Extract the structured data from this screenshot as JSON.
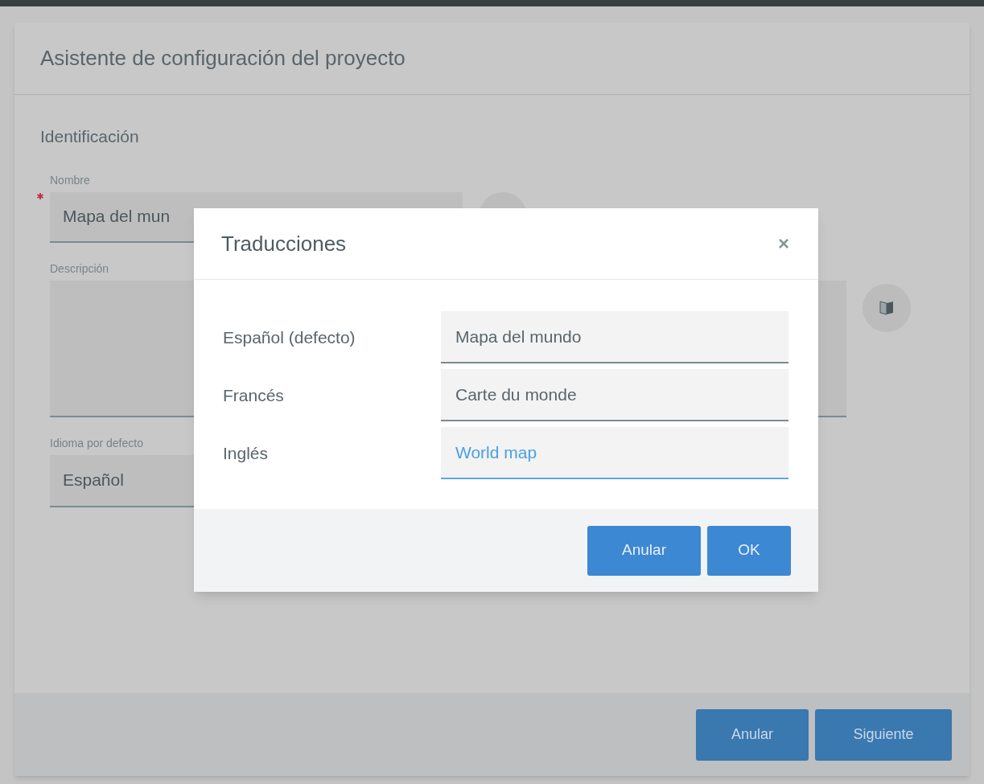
{
  "wizard": {
    "title": "Asistente de configuración del proyecto",
    "section": "Identificación",
    "fields": [
      {
        "kind": "input",
        "label": "Nombre",
        "required": true,
        "value": "Mapa del mun"
      },
      {
        "kind": "textarea",
        "label": "Descripción",
        "required": false
      },
      {
        "kind": "select",
        "label": "Idioma por defecto",
        "required": false,
        "value": "Español"
      }
    ],
    "buttons": [
      "Anular",
      "Siguiente"
    ]
  },
  "translations_dialog": {
    "title": "Traducciones",
    "close": "×",
    "rows": [
      {
        "language": "Español (defecto)",
        "value": "Mapa del mundo",
        "focused": false
      },
      {
        "language": "Francés",
        "value": "Carte du monde",
        "focused": false
      },
      {
        "language": "Inglés",
        "value": "World map",
        "focused": true
      }
    ],
    "buttons": [
      "Anular",
      "OK"
    ]
  }
}
